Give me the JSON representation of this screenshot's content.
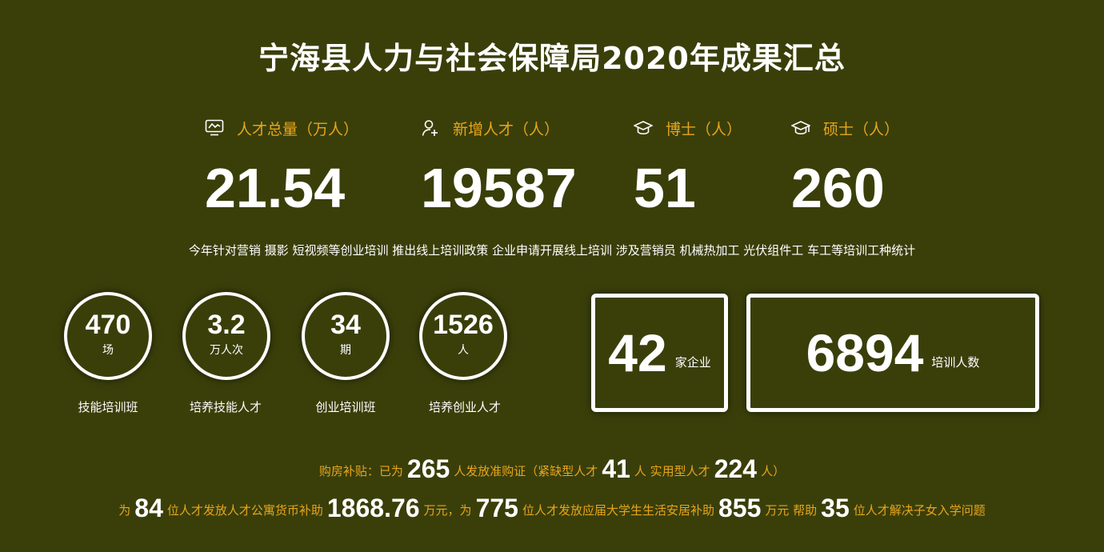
{
  "title": "宁海县人力与社会保障局2020年成果汇总",
  "stats": [
    {
      "label": "人才总量（万人）",
      "value": "21.54",
      "icon": "monitor-chart-icon"
    },
    {
      "label": "新增人才（人）",
      "value": "19587",
      "icon": "add-user-icon"
    },
    {
      "label": "博士（人）",
      "value": "51",
      "icon": "graduation-cap-icon"
    },
    {
      "label": "硕士（人）",
      "value": "260",
      "icon": "graduation-cap-icon"
    }
  ],
  "training_line": "今年针对营销  摄影  短视频等创业培训  推出线上培训政策  企业申请开展线上培训  涉及营销员  机械热加工  光伏组件工  车工等培训工种统计",
  "circles": [
    {
      "value": "470",
      "unit": "场",
      "label": "技能培训班"
    },
    {
      "value": "3.2",
      "unit": "万人次",
      "label": "培养技能人才"
    },
    {
      "value": "34",
      "unit": "期",
      "label": "创业培训班"
    },
    {
      "value": "1526",
      "unit": "人",
      "label": "培养创业人才"
    }
  ],
  "boxes": [
    {
      "value": "42",
      "unit": "家企业"
    },
    {
      "value": "6894",
      "unit": "培训人数"
    }
  ],
  "housing_line": {
    "t1": "购房补贴：已为",
    "n1": "265",
    "t2": "人发放准购证（紧缺型人才",
    "n2": "41",
    "t3": "人  实用型人才",
    "n3": "224",
    "t4": "人）"
  },
  "subsidy_line": {
    "t1": "为",
    "n1": "84",
    "t2": "位人才发放人才公寓货币补助",
    "n2": "1868.76",
    "t3": "万元，为",
    "n3": "775",
    "t4": "位人才发放应届大学生生活安居补助",
    "n4": "855",
    "t5": "万元  帮助",
    "n5": "35",
    "t6": "位人才解决子女入学问题"
  },
  "colors": {
    "background": "#3a3f0a",
    "accent": "#e8a51c",
    "text": "#ffffff"
  }
}
